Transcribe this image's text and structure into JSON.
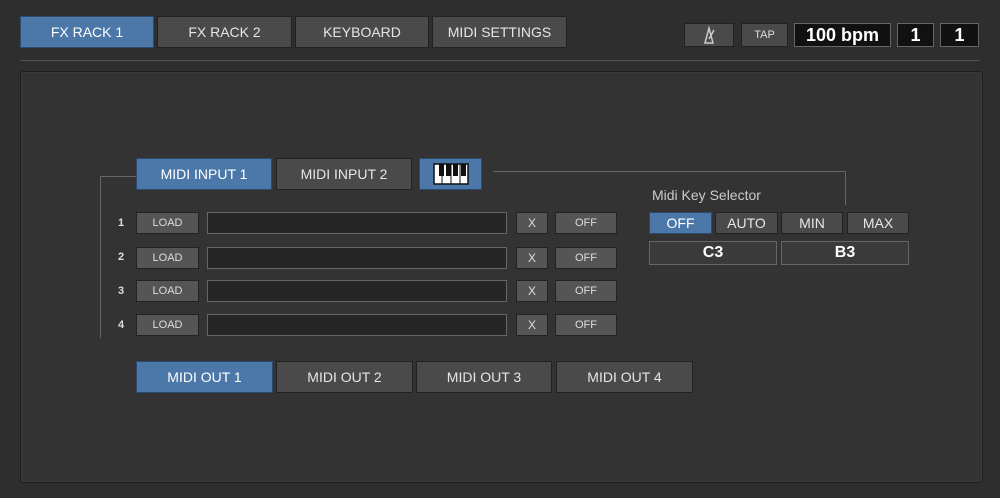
{
  "top_tabs": [
    {
      "label": "FX RACK 1",
      "active": true
    },
    {
      "label": "FX RACK 2",
      "active": false
    },
    {
      "label": "KEYBOARD",
      "active": false
    },
    {
      "label": "MIDI SETTINGS",
      "active": false
    }
  ],
  "transport": {
    "metronome_icon": "metronome-icon",
    "tap_label": "TAP",
    "bpm": "100 bpm",
    "bar": "1",
    "beat": "1"
  },
  "midi_input_tabs": [
    {
      "label": "MIDI INPUT 1",
      "active": true
    },
    {
      "label": "MIDI INPUT 2",
      "active": false
    }
  ],
  "keyboard_icon": "piano-keys-icon",
  "slots": [
    {
      "number": "1",
      "load_label": "LOAD",
      "clear_label": "X",
      "toggle_label": "OFF"
    },
    {
      "number": "2",
      "load_label": "LOAD",
      "clear_label": "X",
      "toggle_label": "OFF"
    },
    {
      "number": "3",
      "load_label": "LOAD",
      "clear_label": "X",
      "toggle_label": "OFF"
    },
    {
      "number": "4",
      "load_label": "LOAD",
      "clear_label": "X",
      "toggle_label": "OFF"
    }
  ],
  "key_selector": {
    "title": "Midi Key Selector",
    "modes": [
      {
        "label": "OFF",
        "active": true
      },
      {
        "label": "AUTO",
        "active": false
      },
      {
        "label": "MIN",
        "active": false
      },
      {
        "label": "MAX",
        "active": false
      }
    ],
    "low_note": "C3",
    "high_note": "B3"
  },
  "midi_out_tabs": [
    {
      "label": "MIDI OUT 1",
      "active": true
    },
    {
      "label": "MIDI OUT 2",
      "active": false
    },
    {
      "label": "MIDI OUT 3",
      "active": false
    },
    {
      "label": "MIDI OUT 4",
      "active": false
    }
  ],
  "colors": {
    "accent": "#4b78a8",
    "panel": "#333333",
    "background": "#2e2e2e"
  }
}
